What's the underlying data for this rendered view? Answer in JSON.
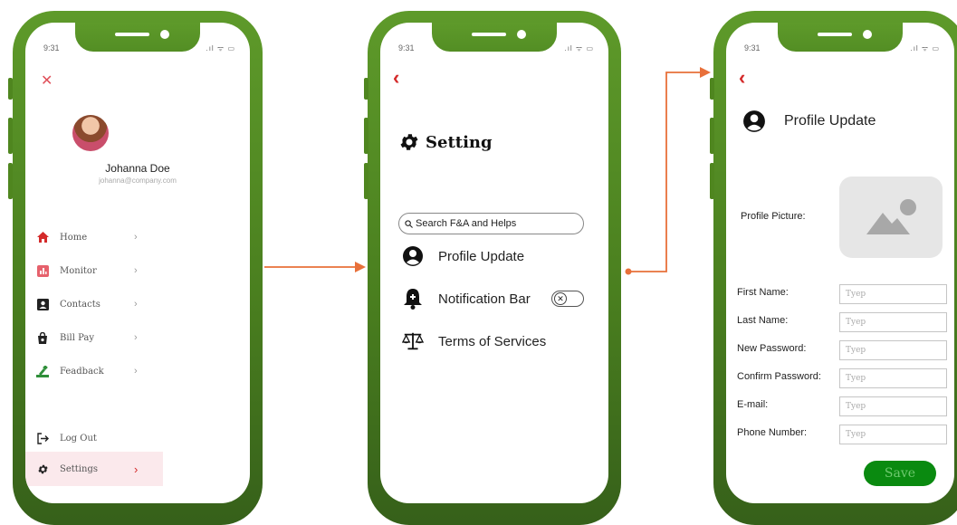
{
  "status_bar": {
    "time": "9:31",
    "signal": ".ıl ᯤ ▭"
  },
  "menu_screen": {
    "user_name": "Johanna Doe",
    "user_email": "johanna@company.com",
    "items": [
      {
        "label": "Home",
        "icon": "home-icon",
        "arrow": "›"
      },
      {
        "label": "Monitor",
        "icon": "monitor-icon",
        "arrow": "›"
      },
      {
        "label": "Contacts",
        "icon": "contacts-icon",
        "arrow": "›"
      },
      {
        "label": "Bill Pay",
        "icon": "bill-pay-icon",
        "arrow": "›"
      },
      {
        "label": "Feadback",
        "icon": "feedback-icon",
        "arrow": "›"
      }
    ],
    "logout_label": "Log Out",
    "settings_label": "Settings",
    "settings_arrow": "›"
  },
  "settings_screen": {
    "title": "Setting",
    "search_placeholder": "Search F&A and Helps",
    "options": [
      {
        "label": "Profile Update",
        "icon": "user-circle-icon"
      },
      {
        "label": "Notification Bar",
        "icon": "bell-icon"
      },
      {
        "label": "Terms of Services",
        "icon": "scale-icon"
      }
    ],
    "toggle_glyph": "✕"
  },
  "profile_screen": {
    "title": "Profile Update",
    "picture_label": "Profile Picture:",
    "fields": [
      {
        "label": "First Name:",
        "placeholder": "Tyep"
      },
      {
        "label": "Last Name:",
        "placeholder": "Tyep"
      },
      {
        "label": "New Password:",
        "placeholder": "Tyep"
      },
      {
        "label": "Confirm Password:",
        "placeholder": "Tyep"
      },
      {
        "label": "E-mail:",
        "placeholder": "Tyep"
      },
      {
        "label": "Phone Number:",
        "placeholder": "Tyep"
      }
    ],
    "save_label": "Save"
  },
  "colors": {
    "phone_green": "#4a7f1f",
    "accent_red": "#d42a2a",
    "flow_arrow": "#e8703a",
    "save_green": "#0a8a10"
  }
}
